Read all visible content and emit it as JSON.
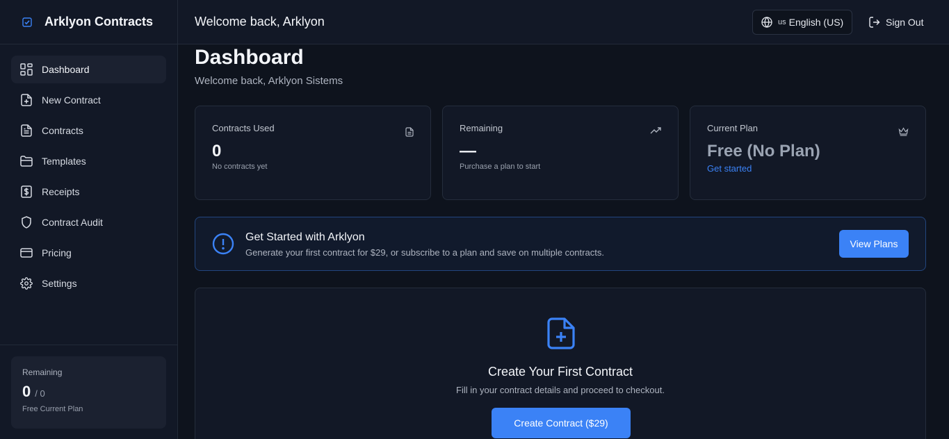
{
  "brand": {
    "title": "Arklyon Contracts"
  },
  "sidebar": {
    "items": [
      {
        "label": "Dashboard",
        "icon": "dashboard-grid-icon",
        "active": true
      },
      {
        "label": "New Contract",
        "icon": "file-plus-icon"
      },
      {
        "label": "Contracts",
        "icon": "file-text-icon"
      },
      {
        "label": "Templates",
        "icon": "folder-icon"
      },
      {
        "label": "Receipts",
        "icon": "receipt-dollar-icon"
      },
      {
        "label": "Contract Audit",
        "icon": "shield-icon"
      },
      {
        "label": "Pricing",
        "icon": "credit-card-icon"
      },
      {
        "label": "Settings",
        "icon": "gear-icon"
      }
    ],
    "remaining": {
      "label": "Remaining",
      "value": "0",
      "total": "/ 0",
      "plan": "Free Current Plan"
    }
  },
  "header": {
    "welcome": "Welcome back, Arklyon",
    "language": {
      "flag": "us",
      "label": "English (US)"
    },
    "signout": "Sign Out"
  },
  "main": {
    "title": "Dashboard",
    "subtitle": "Welcome back, Arklyon Sistems",
    "stats": [
      {
        "label": "Contracts Used",
        "value": "0",
        "note": "No contracts yet",
        "icon": "file-icon"
      },
      {
        "label": "Remaining",
        "value": "—",
        "note": "Purchase a plan to start",
        "icon": "trending-up-icon"
      },
      {
        "label": "Current Plan",
        "value": "Free (No Plan)",
        "link": "Get started",
        "icon": "crown-icon"
      }
    ],
    "banner": {
      "title": "Get Started with Arklyon",
      "text": "Generate your first contract for $29, or subscribe to a plan and save on multiple contracts.",
      "button": "View Plans"
    },
    "empty": {
      "title": "Create Your First Contract",
      "text": "Fill in your contract details and proceed to checkout.",
      "button": "Create Contract ($29)"
    }
  },
  "colors": {
    "accent": "#3b82f6",
    "background": "#0e131d",
    "panel": "#121826"
  }
}
